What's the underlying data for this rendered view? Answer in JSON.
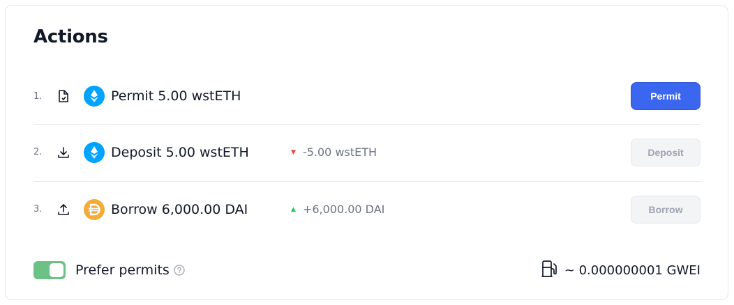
{
  "title": "Actions",
  "actions": [
    {
      "number": "1.",
      "action_icon": "permit-document-icon",
      "token_icon": "wsteth-icon",
      "label": "Permit 5.00 wstETH",
      "delta": "",
      "delta_direction": "",
      "button": "Permit",
      "button_state": "enabled"
    },
    {
      "number": "2.",
      "action_icon": "download-icon",
      "token_icon": "wsteth-icon",
      "label": "Deposit 5.00 wstETH",
      "delta": "-5.00 wstETH",
      "delta_direction": "down",
      "button": "Deposit",
      "button_state": "disabled"
    },
    {
      "number": "3.",
      "action_icon": "upload-icon",
      "token_icon": "dai-icon",
      "label": "Borrow 6,000.00 DAI",
      "delta": "+6,000.00 DAI",
      "delta_direction": "up",
      "button": "Borrow",
      "button_state": "disabled"
    }
  ],
  "footer": {
    "toggle_on": true,
    "prefer_permits_label": "Prefer permits",
    "gas_estimate": "~ 0.000000001 GWEI"
  },
  "colors": {
    "primary": "#3b66f0",
    "toggle": "#6cc184",
    "down": "#ef4444",
    "up": "#22c55e",
    "wsteth": "#00a3ff",
    "dai": "#f5ac37"
  }
}
